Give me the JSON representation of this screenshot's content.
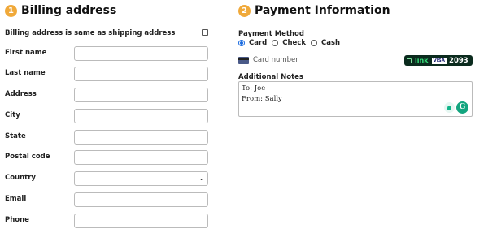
{
  "billing": {
    "step": "1",
    "title": "Billing address",
    "same_as_shipping_label": "Billing address is same as shipping address",
    "fields": [
      {
        "label": "First name",
        "value": ""
      },
      {
        "label": "Last name",
        "value": ""
      },
      {
        "label": "Address",
        "value": ""
      },
      {
        "label": "City",
        "value": ""
      },
      {
        "label": "State",
        "value": ""
      },
      {
        "label": "Postal code",
        "value": ""
      },
      {
        "label": "Country",
        "value": ""
      },
      {
        "label": "Email",
        "value": ""
      },
      {
        "label": "Phone",
        "value": ""
      }
    ]
  },
  "payment": {
    "step": "2",
    "title": "Payment Information",
    "method_label": "Payment Method",
    "options": [
      {
        "label": "Card",
        "selected": true
      },
      {
        "label": "Check",
        "selected": false
      },
      {
        "label": "Cash",
        "selected": false
      }
    ],
    "card_number_placeholder": "Card number",
    "link": {
      "brand": "link",
      "network": "VISA",
      "last4": "2093"
    },
    "notes_label": "Additional Notes",
    "notes_lines": [
      "To: Joe",
      "From: Sally"
    ]
  },
  "colors": {
    "accent": "#f0a93a",
    "radio_selected": "#1a6be0",
    "link_bg": "#0b2b1e",
    "link_green": "#35e07a",
    "grammarly": "#13a57f"
  }
}
